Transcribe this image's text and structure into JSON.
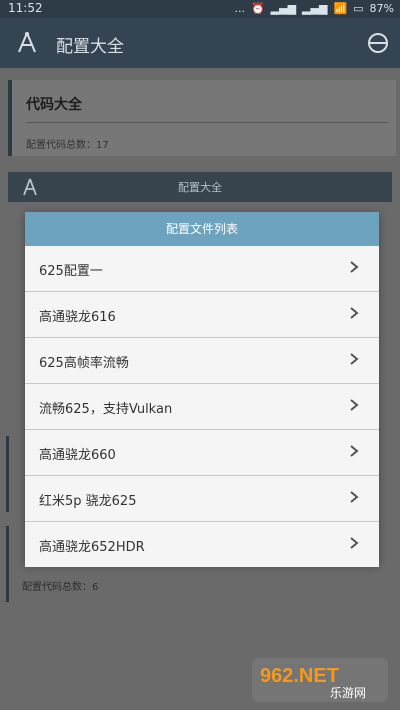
{
  "status": {
    "time": "11:52",
    "dots": "...",
    "battery": "87%"
  },
  "appbar": {
    "title": "配置大全"
  },
  "background": {
    "card_title": "代码大全",
    "card_count": "配置代码总数：17",
    "section_label": "配置大全",
    "count2": "配置代码总数：6"
  },
  "modal": {
    "title": "配置文件列表",
    "items": [
      "625配置一",
      "高通骁龙616",
      "625高帧率流畅",
      "流畅625，支持Vulkan",
      "高通骁龙660",
      "红米5p 骁龙625",
      "高通骁龙652HDR"
    ]
  },
  "watermark": {
    "text": "962.NET",
    "sub": "乐游网"
  }
}
